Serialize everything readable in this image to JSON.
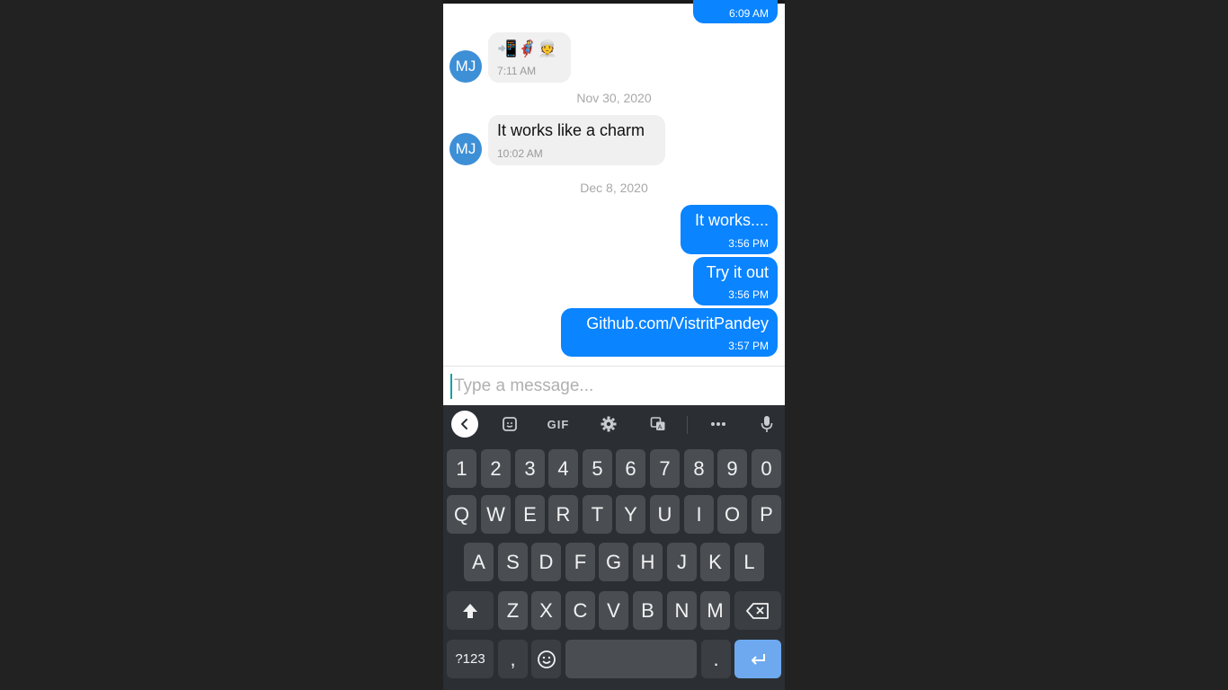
{
  "chat": {
    "messages": [
      {
        "id": "m0",
        "dir": "out",
        "text": "",
        "time": "6:09 AM"
      },
      {
        "id": "m1",
        "dir": "in",
        "avatar": "MJ",
        "emoji": [
          "📲",
          "🦸",
          "👳"
        ],
        "time": "7:11 AM"
      },
      {
        "id": "d1",
        "type": "date",
        "text": "Nov 30, 2020"
      },
      {
        "id": "m2",
        "dir": "in",
        "avatar": "MJ",
        "text": "It works like a charm",
        "time": "10:02 AM"
      },
      {
        "id": "d2",
        "type": "date",
        "text": "Dec 8, 2020"
      },
      {
        "id": "m3",
        "dir": "out",
        "text": "It works....",
        "time": "3:56 PM"
      },
      {
        "id": "m4",
        "dir": "out",
        "text": "Try it out",
        "time": "3:56 PM"
      },
      {
        "id": "m5",
        "dir": "out",
        "text": "Github.com/VistritPandey",
        "time": "3:57 PM"
      }
    ],
    "colors": {
      "outgoing": "#0a84ff",
      "incoming": "#f0f0f0",
      "avatar": "#3d8fd6"
    }
  },
  "composer": {
    "placeholder": "Type a message...",
    "value": ""
  },
  "keyboard": {
    "toolbar": {
      "gif_label": "GIF"
    },
    "rows": {
      "numbers": [
        "1",
        "2",
        "3",
        "4",
        "5",
        "6",
        "7",
        "8",
        "9",
        "0"
      ],
      "row1": [
        "Q",
        "W",
        "E",
        "R",
        "T",
        "Y",
        "U",
        "I",
        "O",
        "P"
      ],
      "row2": [
        "A",
        "S",
        "D",
        "F",
        "G",
        "H",
        "J",
        "K",
        "L"
      ],
      "row3": [
        "Z",
        "X",
        "C",
        "V",
        "B",
        "N",
        "M"
      ]
    },
    "symbols_label": "?123",
    "comma": ",",
    "period": ".",
    "colors": {
      "key": "#4a4e53",
      "enter": "#6ea9ef",
      "background": "#2b2f33"
    }
  }
}
